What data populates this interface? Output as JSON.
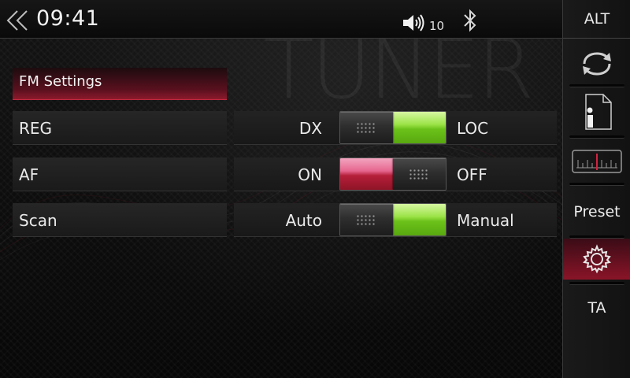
{
  "status_bar": {
    "time": "09:41",
    "volume_level": "10",
    "icons": [
      "back-chevron-icon",
      "volume-icon",
      "bluetooth-icon"
    ]
  },
  "watermark": "TUNER",
  "section": {
    "title": "FM Settings"
  },
  "settings": [
    {
      "label": "REG",
      "left_option": "DX",
      "right_option": "LOC",
      "selected": "LOC"
    },
    {
      "label": "AF",
      "left_option": "ON",
      "right_option": "OFF",
      "selected": "ON"
    },
    {
      "label": "Scan",
      "left_option": "Auto",
      "right_option": "Manual",
      "selected": "Manual"
    }
  ],
  "sidebar": {
    "alt_label": "ALT",
    "preset_label": "Preset",
    "ta_label": "TA",
    "items": [
      {
        "id": "alt",
        "label": "ALT"
      },
      {
        "id": "source",
        "icon": "refresh-icon"
      },
      {
        "id": "info",
        "icon": "info-icon"
      },
      {
        "id": "frequency",
        "icon": "tuner-scale-icon"
      },
      {
        "id": "preset",
        "label": "Preset"
      },
      {
        "id": "settings",
        "icon": "gear-icon",
        "active": true
      },
      {
        "id": "ta",
        "label": "TA"
      }
    ]
  },
  "colors": {
    "accent_red": "#b5203a",
    "toggle_green": "#6cc21a",
    "background": "#0b0b0b",
    "text": "#e9e9e9"
  }
}
